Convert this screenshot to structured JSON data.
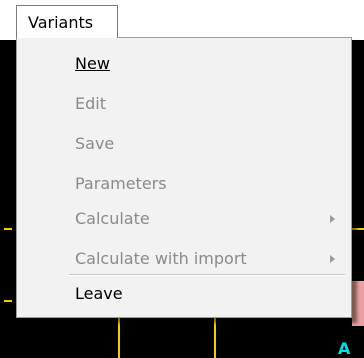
{
  "menubar": {
    "variants_label": "Variants"
  },
  "menu": {
    "items": [
      {
        "label": "New",
        "enabled": true
      },
      {
        "label": "Edit",
        "enabled": false
      },
      {
        "label": "Save",
        "enabled": false
      },
      {
        "label": "Parameters",
        "enabled": false
      },
      {
        "label": "Calculate",
        "enabled": false,
        "submenu": true
      },
      {
        "label": "Calculate with import",
        "enabled": false,
        "submenu": true
      },
      {
        "label": "Leave",
        "enabled": true
      }
    ]
  },
  "background": {
    "marker_text": "A"
  },
  "colors": {
    "menu_bg": "#f2f2f2",
    "disabled_text": "#8a8a8a",
    "grid_yellow": "#f0d000",
    "canvas_black": "#000000"
  }
}
